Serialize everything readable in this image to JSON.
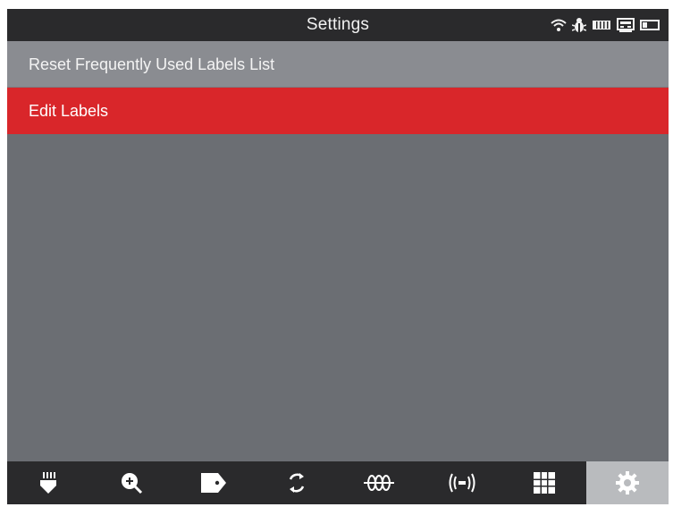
{
  "window": {
    "title": "Settings"
  },
  "status_bar": {
    "icons": [
      "wifi-icon",
      "bug-icon",
      "battery-icon",
      "device-icon",
      "battery-outline-icon"
    ]
  },
  "menu": {
    "items": [
      {
        "label": "Reset Frequently Used Labels List",
        "selected": false
      },
      {
        "label": "Edit Labels",
        "selected": true
      }
    ]
  },
  "toolbar": {
    "items": [
      {
        "icon": "probe-icon",
        "active": false
      },
      {
        "icon": "zoom-in-icon",
        "active": false
      },
      {
        "icon": "label-tag-icon",
        "active": false
      },
      {
        "icon": "refresh-icon",
        "active": false
      },
      {
        "icon": "coil-icon",
        "active": false
      },
      {
        "icon": "signal-icon",
        "active": false
      },
      {
        "icon": "grid-icon",
        "active": false
      },
      {
        "icon": "gear-icon",
        "active": true
      }
    ]
  },
  "colors": {
    "titlebar": "#2a2a2c",
    "background": "#6b6e73",
    "menu_item": "#8a8c91",
    "selected": "#d9262a",
    "toolbar_active": "#b9bbbe"
  }
}
